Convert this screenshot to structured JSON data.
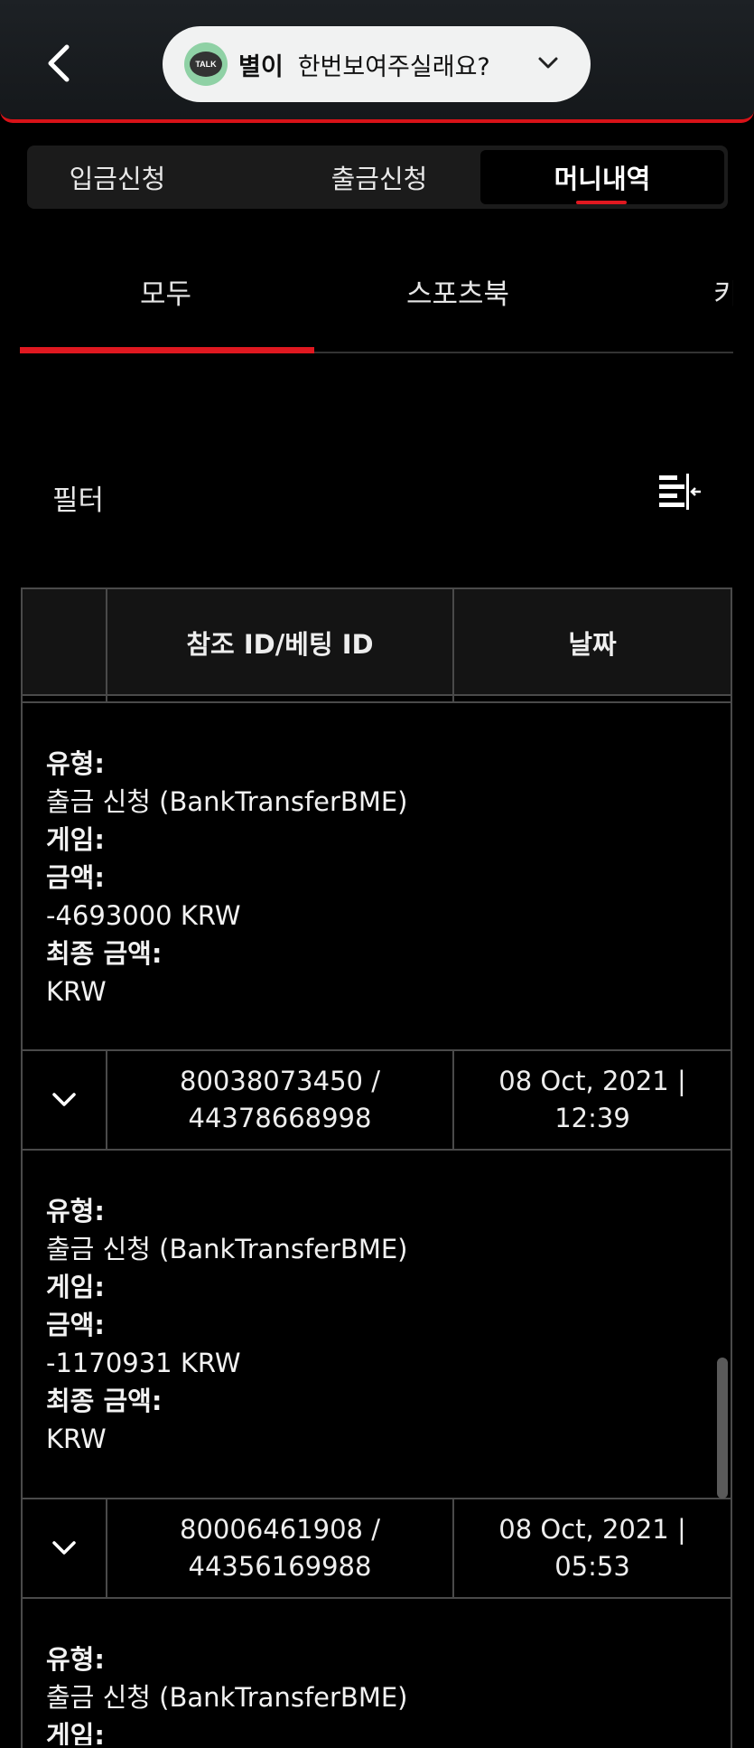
{
  "header": {
    "talk_badge": "TALK",
    "talk_name": "별이",
    "talk_message": "한번보여주실래요?"
  },
  "segments": [
    "입금신청",
    "출금신청",
    "머니내역"
  ],
  "subtabs": [
    "모두",
    "스포츠북",
    "키"
  ],
  "filter": {
    "label": "필터"
  },
  "table": {
    "headers": [
      "참조 ID/베팅 ID",
      "날짜"
    ],
    "labels": {
      "type": "유형:",
      "game": "게임:",
      "amount": "금액:",
      "final": "최종 금액:"
    },
    "details": [
      {
        "type": "출금 신청 (BankTransferBME)",
        "amount": "-4693000 KRW",
        "final": "KRW"
      },
      {
        "type": "출금 신청 (BankTransferBME)",
        "amount": "-1170931 KRW",
        "final": "KRW"
      },
      {
        "type": "출금 신청 (BankTransferBME)"
      }
    ],
    "rows": [
      {
        "ref_line1": "80038073450 /",
        "ref_line2": "44378668998",
        "date_line1": "08 Oct, 2021 |",
        "date_line2": "12:39"
      },
      {
        "ref_line1": "80006461908 /",
        "ref_line2": "44356169988",
        "date_line1": "08 Oct, 2021 |",
        "date_line2": "05:53"
      }
    ],
    "clipped_label": "게임:"
  },
  "colors": {
    "accent": "#e01820",
    "background": "#000000",
    "grid": "#4a4a4a"
  }
}
